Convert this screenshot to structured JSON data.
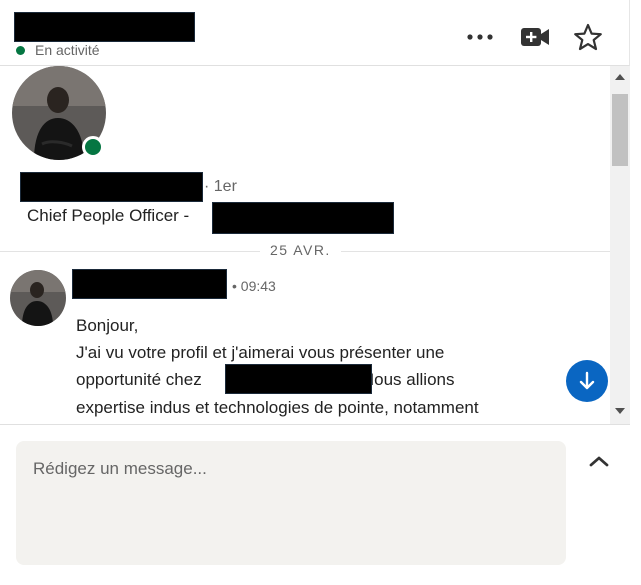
{
  "header": {
    "status": "En activité",
    "icons": [
      "more-icon",
      "video-call-icon",
      "star-icon"
    ]
  },
  "profile": {
    "degree": "· 1er",
    "headline": "Chief People Officer -"
  },
  "conversation": {
    "date_divider": "25 AVR.",
    "message": {
      "time": "• 09:43",
      "lines": [
        "Bonjour,",
        "J'ai vu votre profil et j'aimerai vous présenter une",
        "opportunité chez ",
        ". Nous allions",
        "expertise indus et technologies de pointe, notamment"
      ]
    }
  },
  "composer": {
    "placeholder": "Rédigez un message..."
  },
  "colors": {
    "online": "#057642",
    "accent": "#0a66c2",
    "composer_bg": "#f3f2ef"
  }
}
